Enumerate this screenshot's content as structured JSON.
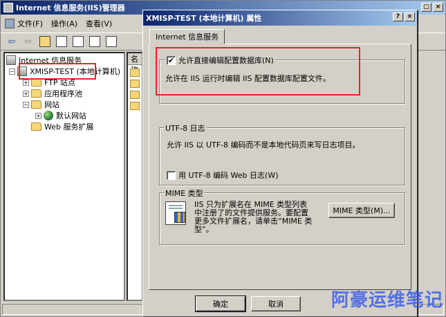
{
  "main_window": {
    "title": "Internet 信息服务(IIS)管理器",
    "menu": [
      "文件(F)",
      "操作(A)",
      "查看(V)"
    ],
    "list_header": "名称"
  },
  "tree": {
    "root": "Internet 信息服务",
    "server": "XMISP-TEST (本地计算机)",
    "ftp_sites": "FTP 站点",
    "app_pools": "应用程序池",
    "websites": "网站",
    "default_site": "默认网站",
    "web_extensions": "Web 服务扩展"
  },
  "dialog": {
    "title": "XMISP-TEST (本地计算机) 属性",
    "help_btn": "?",
    "close_btn": "×",
    "tab_label": "Internet 信息服务",
    "direct_edit": {
      "checkbox_label": "允许直接编辑配置数据库(N)",
      "checked": true,
      "description": "允许在 IIS 运行时编辑 IIS 配置数据库配置文件。"
    },
    "utf8_group": {
      "caption": "UTF-8 日志",
      "description": "允许 IIS 以 UTF-8 编码而不是本地代码页来写日志项目。",
      "checkbox_label": "用 UTF-8 编码 Web 日志(W)",
      "checked": false
    },
    "mime_group": {
      "caption": "MIME 类型",
      "text_lines": [
        "IIS 只为扩展名在 MIME 类型列表",
        "中注册了的文件提供服务。要配置",
        "更多文件扩展名，请单击“MIME 类",
        "型”。"
      ],
      "button_label": "MIME 类型(M)..."
    },
    "ok_button": "确定",
    "cancel_button": "取消"
  },
  "watermark": "阿豪运维笔记",
  "colors": {
    "highlight_box": "#e8232a",
    "titlebar": "#0a246a",
    "watermark": "#3d5fe8"
  }
}
